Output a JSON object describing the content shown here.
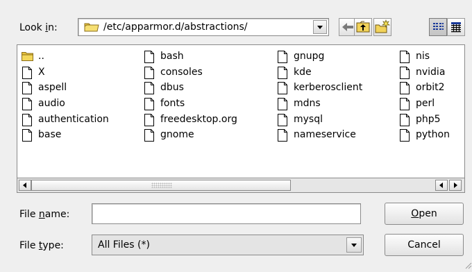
{
  "look_in": {
    "label_pre": "Look ",
    "label_accel": "i",
    "label_post": "n:",
    "path": "/etc/apparmor.d/abstractions/"
  },
  "toolbar": {
    "back": "back-arrow-icon",
    "up": "folder-up-icon",
    "new_folder": "new-folder-icon",
    "list_view": "list-view-icon",
    "detail_view": "detail-view-icon"
  },
  "files": {
    "col1": [
      "..",
      "X",
      "aspell",
      "audio",
      "authentication",
      "base"
    ],
    "col2": [
      "bash",
      "consoles",
      "dbus",
      "fonts",
      "freedesktop.org",
      "gnome"
    ],
    "col3": [
      "gnupg",
      "kde",
      "kerberosclient",
      "mdns",
      "mysql",
      "nameservice"
    ],
    "col4": [
      "nis",
      "nvidia",
      "orbit2",
      "perl",
      "php5",
      "python"
    ]
  },
  "file_name": {
    "label_pre": "File ",
    "label_accel": "n",
    "label_post": "ame:",
    "value": ""
  },
  "file_type": {
    "label_pre": "File ",
    "label_accel": "t",
    "label_post": "ype:",
    "value": "All Files (*)"
  },
  "buttons": {
    "open_accel": "O",
    "open_rest": "pen",
    "cancel": "Cancel"
  },
  "colors": {
    "folder": "#f3d75a",
    "background": "#efefef"
  }
}
